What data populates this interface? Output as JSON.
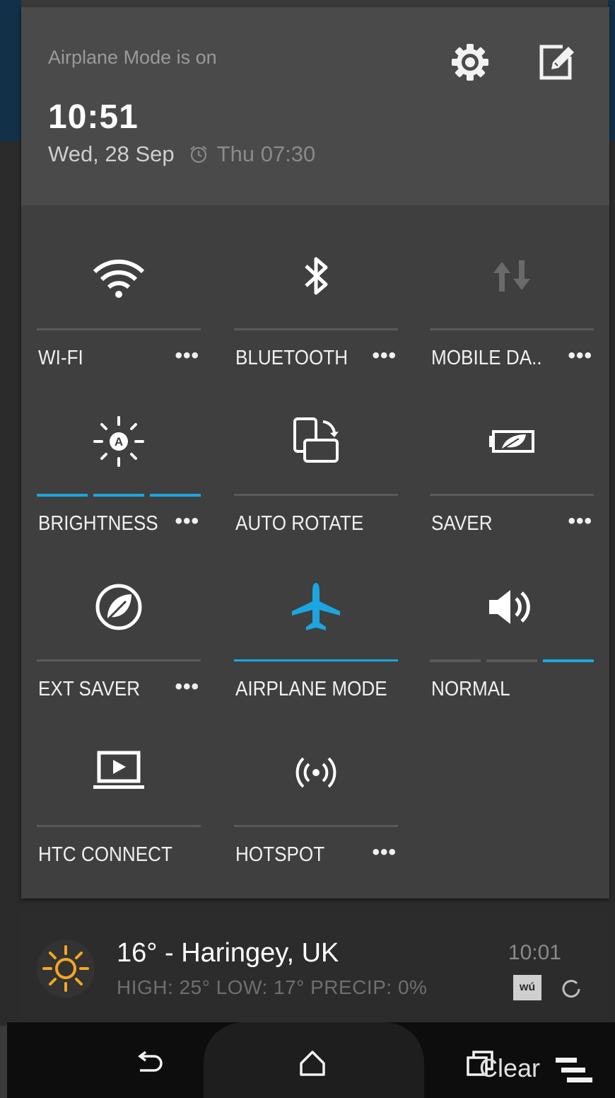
{
  "header": {
    "status_text": "Airplane Mode is on",
    "time": "10:51",
    "date": "Wed, 28 Sep",
    "alarm": "Thu 07:30"
  },
  "tiles": [
    {
      "label": "WI-FI",
      "has_more": true,
      "active": false,
      "icon": "wifi-icon"
    },
    {
      "label": "BLUETOOTH",
      "has_more": true,
      "active": false,
      "icon": "bluetooth-icon"
    },
    {
      "label": "MOBILE DA..",
      "has_more": true,
      "active": false,
      "icon": "mobile-data-icon"
    },
    {
      "label": "BRIGHTNESS",
      "has_more": true,
      "active": true,
      "icon": "brightness-auto-icon"
    },
    {
      "label": "AUTO ROTATE",
      "has_more": false,
      "active": false,
      "icon": "auto-rotate-icon"
    },
    {
      "label": "SAVER",
      "has_more": true,
      "active": false,
      "icon": "power-saver-icon"
    },
    {
      "label": "EXT SAVER",
      "has_more": true,
      "active": false,
      "icon": "extreme-saver-icon"
    },
    {
      "label": "AIRPLANE MODE",
      "has_more": false,
      "active": true,
      "icon": "airplane-icon"
    },
    {
      "label": "NORMAL",
      "has_more": false,
      "active": true,
      "icon": "volume-icon"
    },
    {
      "label": "HTC CONNECT",
      "has_more": false,
      "active": false,
      "icon": "htc-connect-icon"
    },
    {
      "label": "HOTSPOT",
      "has_more": true,
      "active": false,
      "icon": "hotspot-icon"
    }
  ],
  "more_glyph": "•••",
  "brightness_level_segments": 3,
  "volume_level": {
    "segments": 3,
    "active_index": 2
  },
  "weather": {
    "title": "16° - Haringey, UK",
    "details": "HIGH: 25° LOW: 17° PRECIP: 0%",
    "updated": "10:01",
    "logo": "wú"
  },
  "navbar": {
    "clear_label": "Clear"
  },
  "colors": {
    "accent": "#1ba6e0",
    "sun": "#f5a623"
  }
}
